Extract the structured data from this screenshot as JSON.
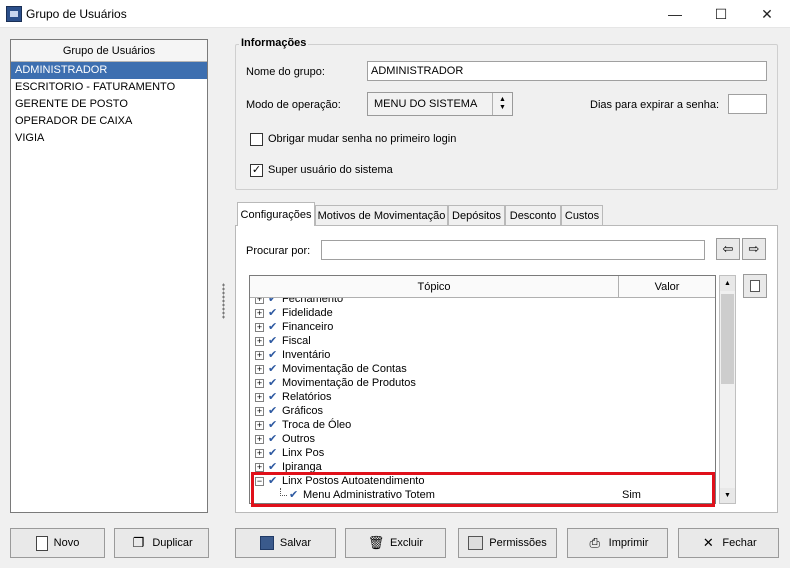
{
  "window": {
    "title": "Grupo de Usuários",
    "minimize": "—",
    "maximize": "☐",
    "close": "✕"
  },
  "groups": {
    "header": "Grupo de Usuários",
    "items": [
      "ADMINISTRADOR",
      "ESCRITORIO - FATURAMENTO",
      "GERENTE DE POSTO",
      "OPERADOR DE CAIXA",
      "VIGIA"
    ],
    "selected_index": 0
  },
  "info": {
    "title": "Informações",
    "group_name_label": "Nome do grupo:",
    "group_name_value": "ADMINISTRADOR",
    "mode_label": "Modo de operação:",
    "mode_value": "MENU DO SISTEMA",
    "days_label": "Dias para expirar a senha:",
    "days_value": "",
    "force_change_label": "Obrigar mudar senha no primeiro login",
    "force_change_checked": false,
    "superuser_label": "Super usuário do sistema",
    "superuser_checked": true
  },
  "tabs": [
    "Configurações",
    "Motivos de Movimentação",
    "Depósitos",
    "Desconto",
    "Custos"
  ],
  "active_tab": 0,
  "search": {
    "label": "Procurar por:",
    "value": ""
  },
  "grid": {
    "columns": [
      "Tópico",
      "Valor"
    ],
    "rows": [
      {
        "label": "Fechamento",
        "expander": "+",
        "value": ""
      },
      {
        "label": "Fidelidade",
        "expander": "+",
        "value": ""
      },
      {
        "label": "Financeiro",
        "expander": "+",
        "value": ""
      },
      {
        "label": "Fiscal",
        "expander": "+",
        "value": ""
      },
      {
        "label": "Inventário",
        "expander": "+",
        "value": ""
      },
      {
        "label": "Movimentação de Contas",
        "expander": "+",
        "value": ""
      },
      {
        "label": "Movimentação de Produtos",
        "expander": "+",
        "value": ""
      },
      {
        "label": "Relatórios",
        "expander": "+",
        "value": ""
      },
      {
        "label": "Gráficos",
        "expander": "+",
        "value": ""
      },
      {
        "label": "Troca de Óleo",
        "expander": "+",
        "value": ""
      },
      {
        "label": "Outros",
        "expander": "+",
        "value": ""
      },
      {
        "label": "Linx Pos",
        "expander": "+",
        "value": ""
      },
      {
        "label": "Ipiranga",
        "expander": "+",
        "value": ""
      },
      {
        "label": "Linx Postos Autoatendimento",
        "expander": "−",
        "value": ""
      },
      {
        "label": "Menu Administrativo Totem",
        "expander": "",
        "value": "Sim",
        "child": true
      }
    ]
  },
  "buttons": {
    "novo": "Novo",
    "duplicar": "Duplicar",
    "salvar": "Salvar",
    "excluir": "Excluir",
    "permissoes": "Permissões",
    "imprimir": "Imprimir",
    "fechar": "Fechar"
  },
  "icons": {
    "check": "✔",
    "arrow_left": "⇦",
    "arrow_right": "⇨"
  },
  "colors": {
    "selection": "#3d6fb0",
    "highlight_border": "#e0101a",
    "check": "#2c58a0"
  }
}
